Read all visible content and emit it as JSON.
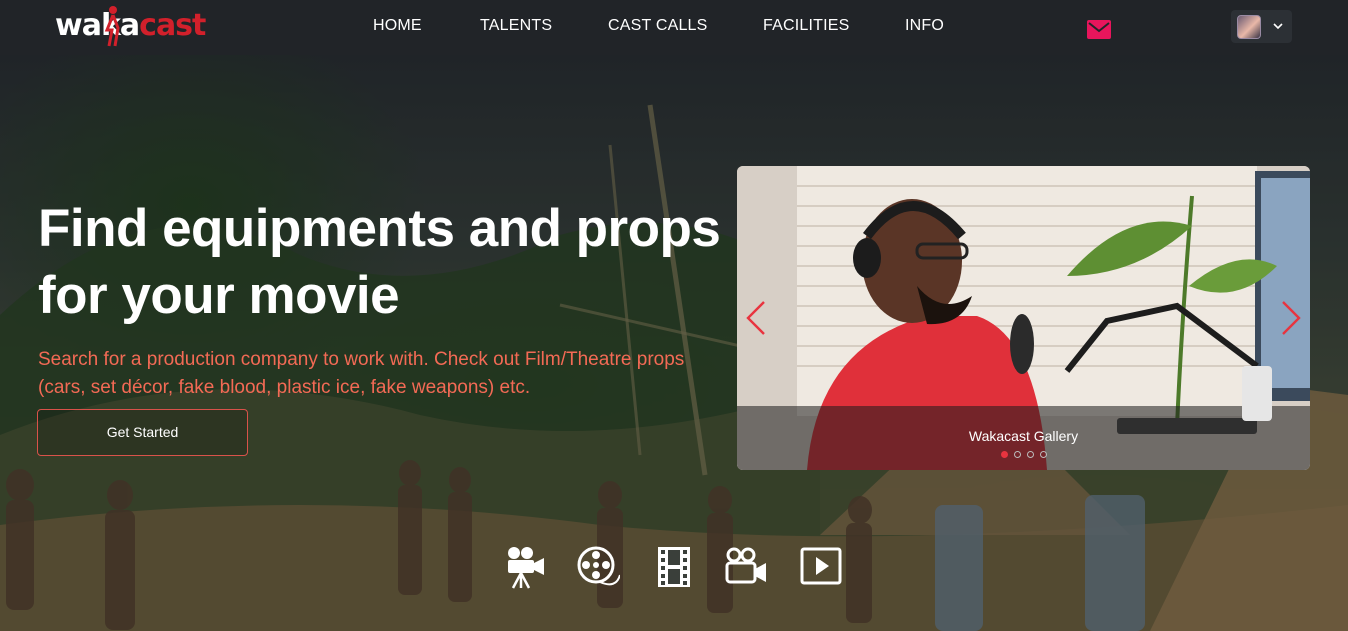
{
  "header": {
    "logo": {
      "part1": "waka",
      "part2": "cast"
    },
    "nav": [
      {
        "label": "HOME"
      },
      {
        "label": "TALENTS"
      },
      {
        "label": "CAST CALLS"
      },
      {
        "label": "FACILITIES"
      },
      {
        "label": "INFO"
      }
    ],
    "icons": {
      "mail": "mail-icon",
      "user": "avatar",
      "dropdown": "chevron-down-icon"
    },
    "accent_color": "#e8155c"
  },
  "hero": {
    "headline": "Find equipments and props for your movie",
    "subtext": "Search for a production company to work with. Check out Film/Theatre props (cars, set décor, fake blood, plastic ice, fake weapons) etc.",
    "cta_label": "Get Started",
    "text_color": "#f36a55"
  },
  "carousel": {
    "caption": "Wakacast Gallery",
    "slide_count": 4,
    "active_slide": 1,
    "arrow_color": "#e8343f"
  },
  "feature_icons": [
    {
      "icon": "film-camera-icon"
    },
    {
      "icon": "film-reel-icon"
    },
    {
      "icon": "film-strip-icon"
    },
    {
      "icon": "video-camera-icon"
    },
    {
      "icon": "play-icon"
    }
  ]
}
